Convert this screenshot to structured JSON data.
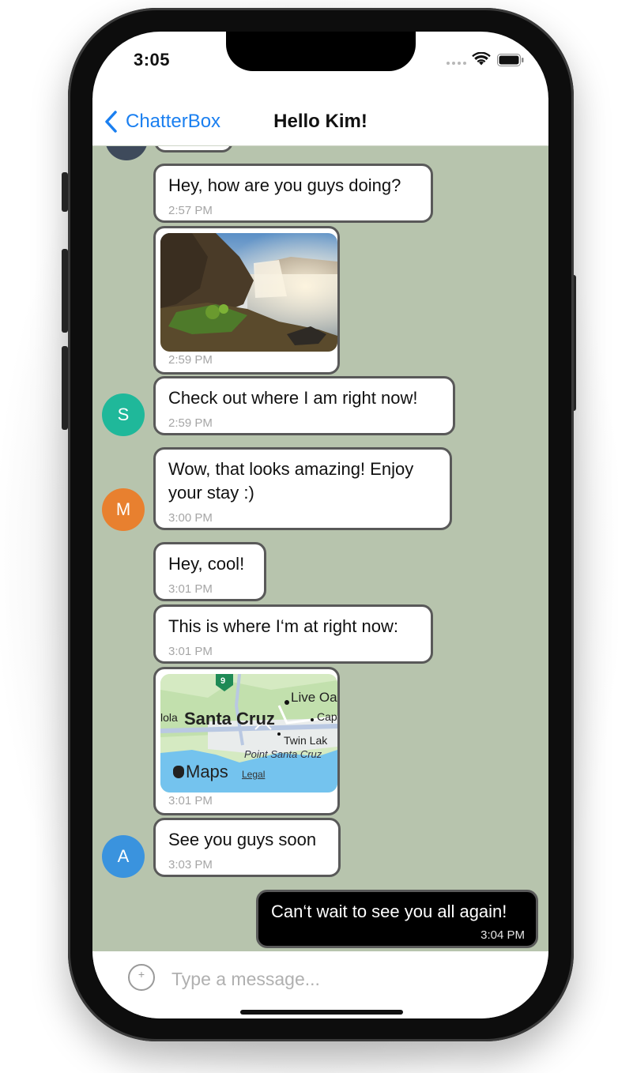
{
  "status_bar": {
    "time": "3:05",
    "icons": [
      "signal-icon",
      "wifi-icon",
      "battery-icon"
    ]
  },
  "navbar": {
    "back_label": "ChatterBox",
    "title": "Hello Kim!"
  },
  "messages": [
    {
      "type": "text",
      "text": "Hey, how are you guys doing?",
      "time": "2:57 PM"
    },
    {
      "type": "image",
      "image": "waterfall-photo",
      "time": "2:59 PM"
    },
    {
      "type": "text",
      "text": "Check out where I am right now!",
      "time": "2:59 PM",
      "avatar": "S"
    },
    {
      "type": "text",
      "text_line1": "Wow, that looks amazing! Enjoy",
      "text_line2": "your stay :)",
      "time": "3:00 PM",
      "avatar": "M"
    },
    {
      "type": "text",
      "text": "Hey, cool!",
      "time": "3:01 PM"
    },
    {
      "type": "text",
      "text": "This is where I‘m at right now:",
      "time": "3:01 PM"
    },
    {
      "type": "map",
      "time": "3:01 PM",
      "map": {
        "city": "Santa Cruz",
        "route": "9",
        "places": [
          "Live Oa",
          "Cap",
          "Twin Lak",
          "Point Santa Cruz",
          "lola"
        ],
        "brand": "Maps",
        "legal": "Legal"
      }
    },
    {
      "type": "text",
      "text": "See you guys soon",
      "time": "3:03 PM",
      "avatar": "A"
    },
    {
      "type": "text",
      "text": "Can‘t wait to see you all again!",
      "time": "3:04 PM",
      "outgoing": true
    }
  ],
  "composer": {
    "placeholder": "Type a message..."
  },
  "colors": {
    "accent": "#1a7ff0",
    "chat_background": "#b7c4ad",
    "avatar_S": "#1fb89a",
    "avatar_M": "#e8802f",
    "avatar_A": "#3a93de"
  }
}
